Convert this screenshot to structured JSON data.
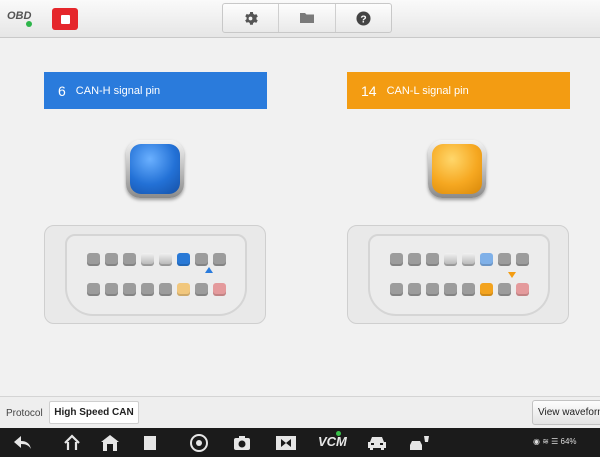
{
  "topbar": {
    "logo_text": "OBD",
    "icons": [
      "stop-icon",
      "gear-icon",
      "folder-icon",
      "help-icon"
    ]
  },
  "can_high": {
    "pin": "6",
    "label": "CAN-H signal pin",
    "color": "#2a7bdc"
  },
  "can_low": {
    "pin": "14",
    "label": "CAN-L signal pin",
    "color": "#f39c12"
  },
  "protocol": {
    "label": "Protocol",
    "value": "High Speed CAN"
  },
  "wave_button": {
    "label": "View waveform"
  },
  "navbar": {
    "vcm_label": "VCM",
    "status_text": "64%",
    "icons": [
      "back-icon",
      "home-icon",
      "house-icon",
      "recent-apps-icon",
      "browser-icon",
      "camera-icon",
      "screen-record-icon",
      "vcm-icon",
      "car-icon",
      "car-service-icon"
    ]
  }
}
